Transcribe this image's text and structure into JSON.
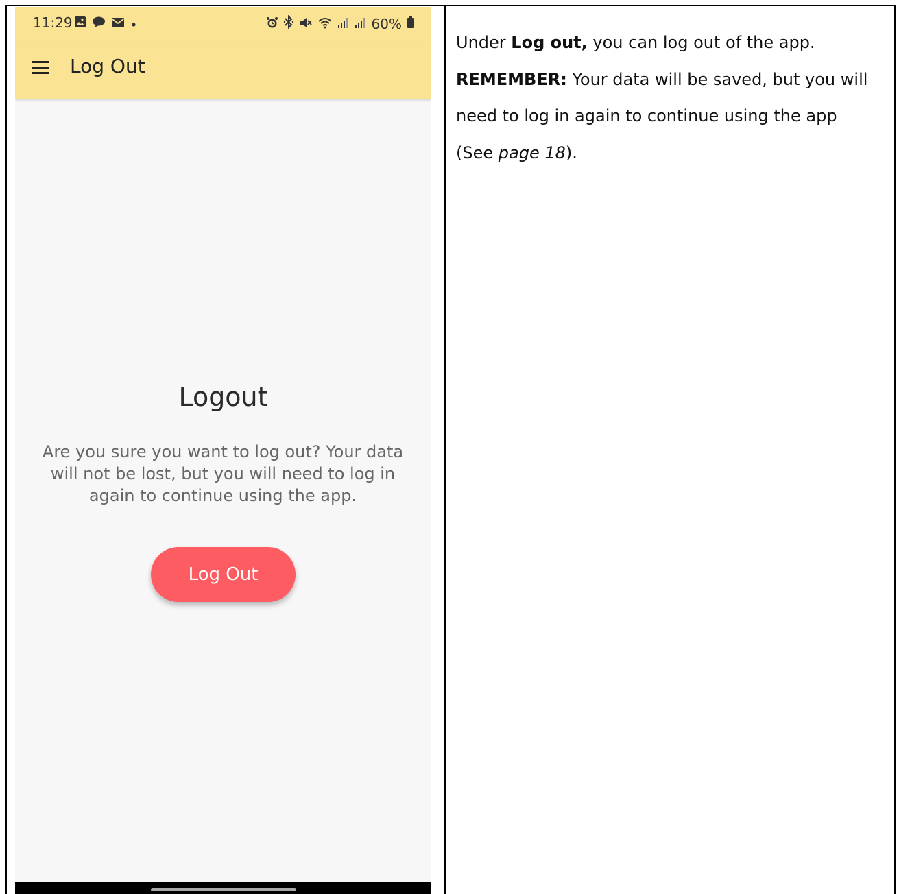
{
  "status_bar": {
    "time": "11:29",
    "left_icons": [
      "gallery-icon",
      "chat-bubble-icon",
      "mail-icon",
      "dot-icon"
    ],
    "right_icons": [
      "alarm-icon",
      "bluetooth-icon",
      "mute-icon",
      "wifi-icon",
      "signal-icon",
      "signal-icon"
    ],
    "battery": "60%"
  },
  "app_bar": {
    "title": "Log Out",
    "menu_icon": "hamburger-menu-icon"
  },
  "logout_screen": {
    "heading": "Logout",
    "message": "Are you sure you want to log out? Your data will not be lost, but you will need to log in again to continue using the app.",
    "button_label": "Log Out"
  },
  "colors": {
    "app_bar_bg": "#fae393",
    "button_bg": "#fd5c63",
    "screen_bg": "#f8f7f8"
  },
  "instructions": {
    "line1_prefix": "Under ",
    "line1_bold": "Log out,",
    "line1_suffix": " you can log out of the app.",
    "remember_label": "REMEMBER:",
    "remember_text": " Your data will be saved, but you will need to log in again to continue using the app",
    "see_open": "(See ",
    "see_page": "page 18",
    "see_close": ")."
  }
}
